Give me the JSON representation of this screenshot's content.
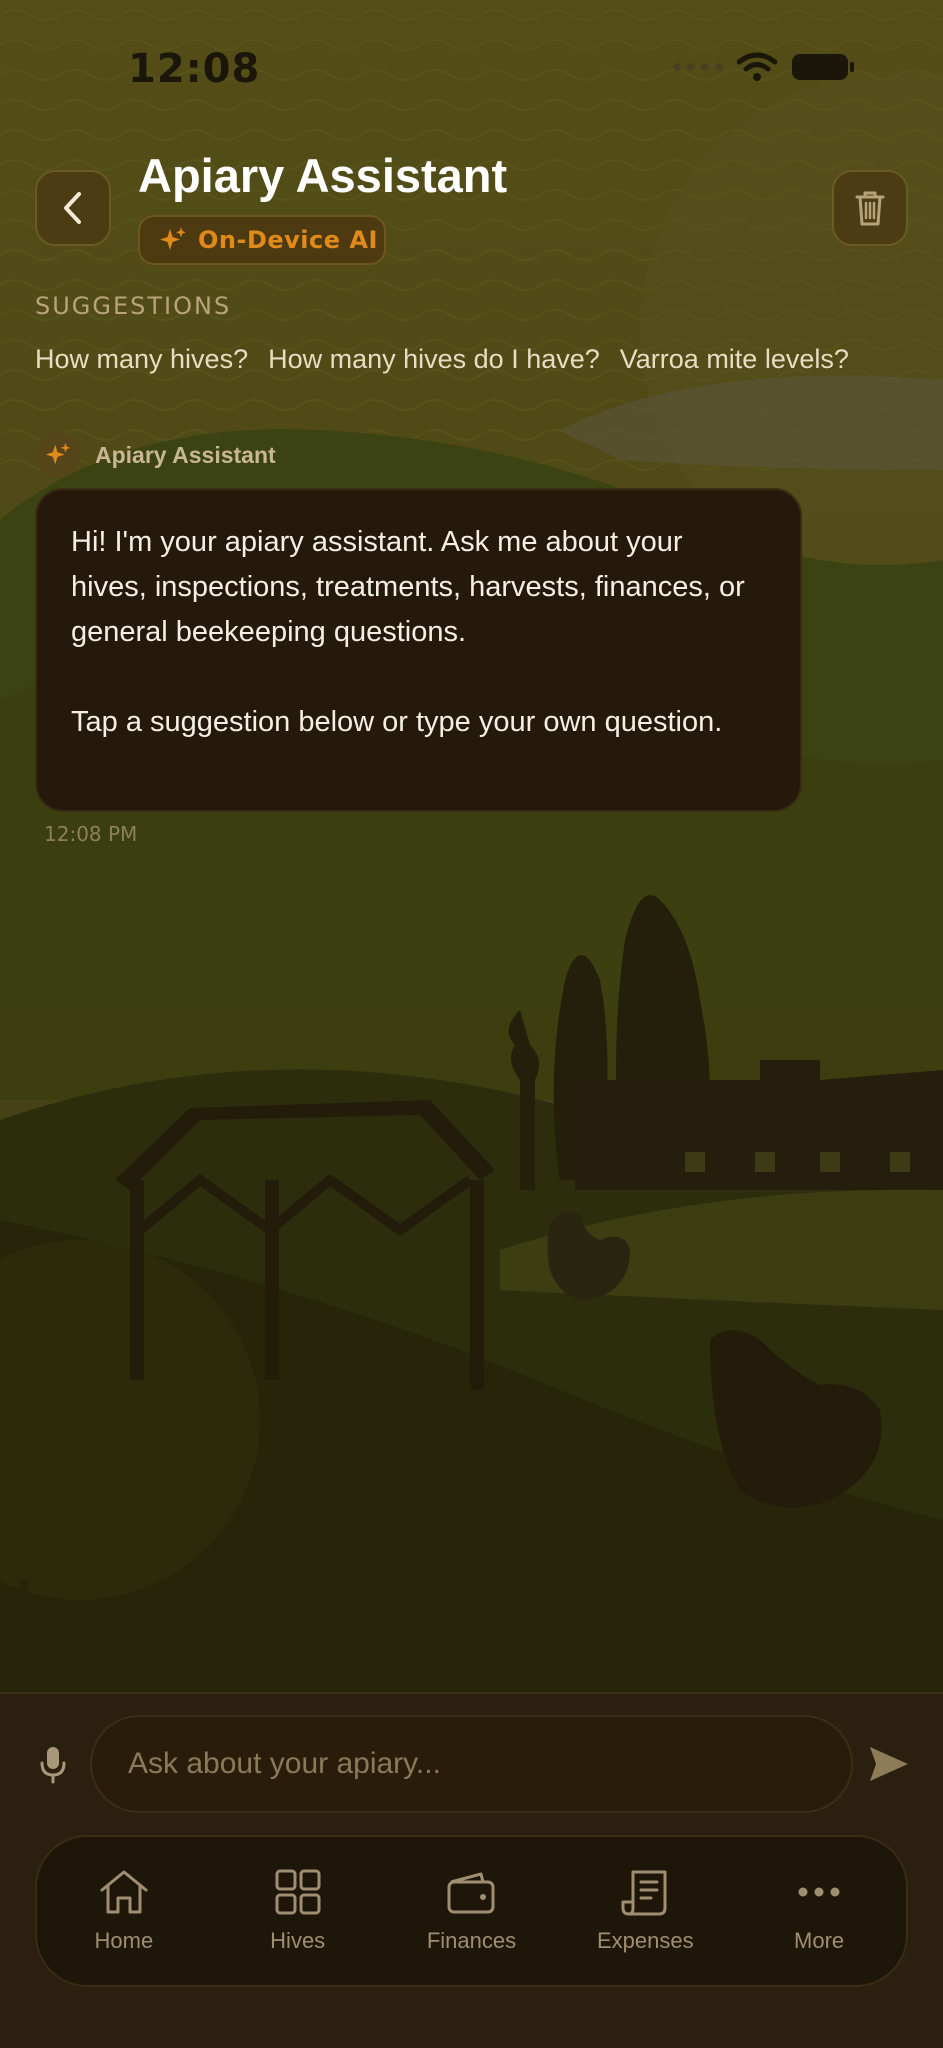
{
  "status": {
    "time": "12:08"
  },
  "header": {
    "title": "Apiary Assistant",
    "badge": "On-Device AI"
  },
  "suggestions": {
    "heading": "SUGGESTIONS",
    "items": [
      "How many hives?",
      "How many hives do I have?",
      "Varroa mite levels?"
    ]
  },
  "message": {
    "sender": "Apiary Assistant",
    "paragraph1": "Hi! I'm your apiary assistant. Ask me about your hives, inspections, treatments, harvests, finances, or general beekeeping questions.",
    "paragraph2": "Tap a suggestion below or type your own question.",
    "time": "12:08 PM"
  },
  "composer": {
    "placeholder": "Ask about your apiary..."
  },
  "tabs": [
    {
      "label": "Home",
      "icon": "home-icon"
    },
    {
      "label": "Hives",
      "icon": "grid-icon"
    },
    {
      "label": "Finances",
      "icon": "wallet-icon"
    },
    {
      "label": "Expenses",
      "icon": "receipt-icon"
    },
    {
      "label": "More",
      "icon": "more-icon"
    }
  ],
  "colors": {
    "accent": "#e08a1c",
    "background": "#2a230f",
    "bubble": "#24190a"
  }
}
